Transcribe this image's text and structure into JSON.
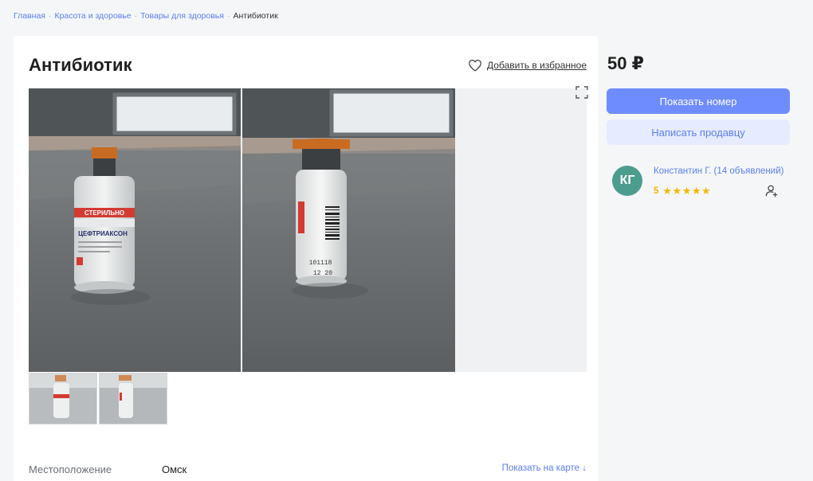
{
  "breadcrumbs": {
    "items": [
      "Главная",
      "Красота и здоровье",
      "Товары для здоровья"
    ],
    "separator": "·",
    "current": "Антибиотик"
  },
  "listing": {
    "title": "Антибиотик",
    "favorite_label": "Добавить в избранное",
    "price": "50 ₽",
    "location_label": "Местоположение",
    "location_value": "Омск",
    "map_link": "Показать на карте ↓"
  },
  "photo_labels": {
    "vial1_sticker": "СТЕРИЛЬНО",
    "vial1_name": "ЦЕФТРИАКСОН",
    "vial2_code1": "101118",
    "vial2_code2": "12 20"
  },
  "actions": {
    "show_phone": "Показать номер",
    "write_seller": "Написать продавцу"
  },
  "seller": {
    "initials": "КГ",
    "name": "Константин Г. (14 объявлений)",
    "rating_value": "5",
    "stars": "★★★★★"
  },
  "colors": {
    "accent": "#6f8cff",
    "link": "#5a7ff2",
    "avatar": "#4d9d8e",
    "star": "#f2b705"
  },
  "icons": [
    "heart-icon",
    "expand-icon",
    "subscribe-user-icon",
    "star-icon"
  ]
}
